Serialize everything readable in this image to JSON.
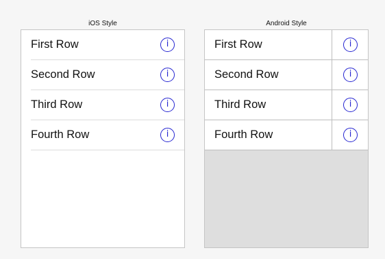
{
  "ios": {
    "caption": "iOS Style",
    "rows": [
      {
        "label": "First Row",
        "icon": "i"
      },
      {
        "label": "Second Row",
        "icon": "i"
      },
      {
        "label": "Third Row",
        "icon": "i"
      },
      {
        "label": "Fourth Row",
        "icon": "i"
      }
    ]
  },
  "android": {
    "caption": "Android Style",
    "rows": [
      {
        "label": "First Row",
        "icon": "i"
      },
      {
        "label": "Second Row",
        "icon": "i"
      },
      {
        "label": "Third Row",
        "icon": "i"
      },
      {
        "label": "Fourth Row",
        "icon": "i"
      }
    ]
  },
  "colors": {
    "accent": "#2323d0",
    "empty_area": "#dedede",
    "background": "#f6f6f6"
  }
}
